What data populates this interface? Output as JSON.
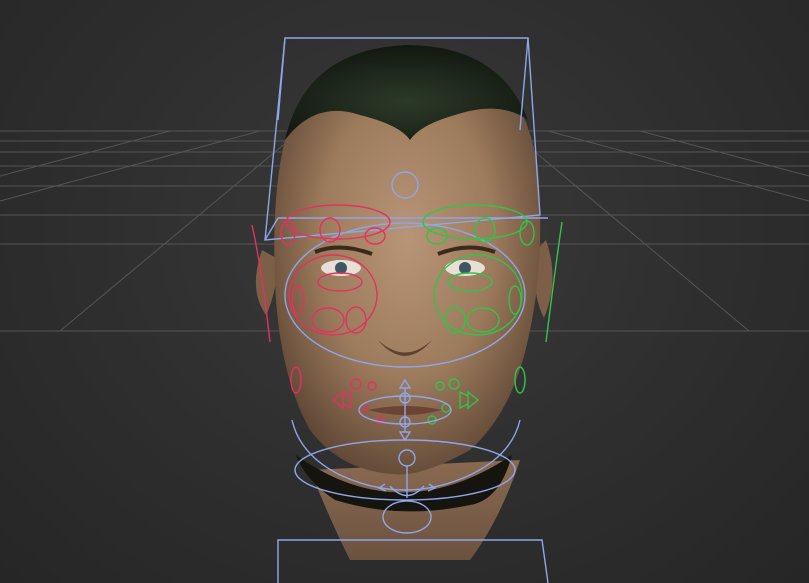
{
  "viewport": {
    "background": "#2e2e2e",
    "grid_color": "#555555",
    "head_skin_color": "#a88668",
    "hair_color": "#1f2b1c",
    "controls": {
      "center_color": "#8fa6e8",
      "right_side_color": "#e0335f",
      "left_side_color": "#34c24a"
    }
  }
}
